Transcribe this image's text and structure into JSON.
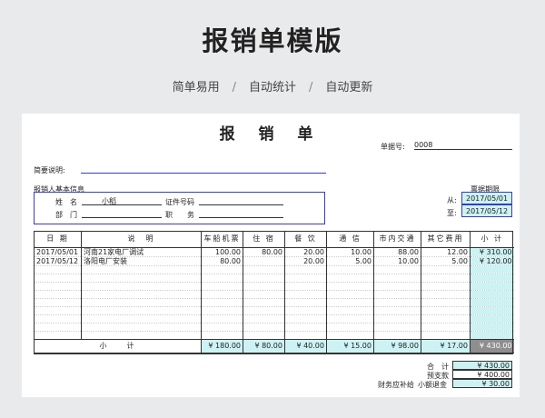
{
  "header": {
    "title": "报销单模版",
    "subtitles": [
      "简单易用",
      "自动统计",
      "自动更新"
    ],
    "separator": "/"
  },
  "form": {
    "title": "报 销 单",
    "doc_no_label": "单据号:",
    "doc_no_value": "0008",
    "brief_label": "简要说明:",
    "basic_info_label": "报销人基本信息",
    "name_label": "姓　名",
    "name_value": "小稻",
    "id_label": "证件号码",
    "dept_label": "部　门",
    "position_label": "职　　务",
    "period_label": "票据期限",
    "from_label": "从:",
    "from_value": "2017/05/01",
    "to_label": "至:",
    "to_value": "2017/05/12"
  },
  "table": {
    "headers": [
      "日 期",
      "说　明",
      "车船机票",
      "住 宿",
      "餐 饮",
      "通 信",
      "市内交通",
      "其它费用",
      "小 计"
    ],
    "rows": [
      {
        "date": "2017/05/01",
        "desc": "河南21家电厂调试",
        "ticket": "100.00",
        "lodging": "80.00",
        "meal": "20.00",
        "comm": "10.00",
        "transport": "88.00",
        "other": "12.00",
        "subtotal": "¥ 310.00"
      },
      {
        "date": "2017/05/12",
        "desc": "洛阳电厂安装",
        "ticket": "80.00",
        "lodging": "",
        "meal": "20.00",
        "comm": "5.00",
        "transport": "10.00",
        "other": "5.00",
        "subtotal": "¥ 120.00"
      }
    ],
    "total_label": "小　　计",
    "totals": {
      "ticket": "¥ 180.00",
      "lodging": "¥ 80.00",
      "meal": "¥ 40.00",
      "comm": "¥ 15.00",
      "transport": "¥ 98.00",
      "other": "¥ 17.00",
      "subtotal": "¥ 430.00"
    }
  },
  "summary": {
    "total_label": "合　计",
    "total_value": "¥ 430.00",
    "advance_label": "预支款",
    "advance_value": "¥ 400.00",
    "finance_label": "财务应补给",
    "small_refund_label": "小额退金",
    "small_refund_value": "¥ 30.00"
  }
}
